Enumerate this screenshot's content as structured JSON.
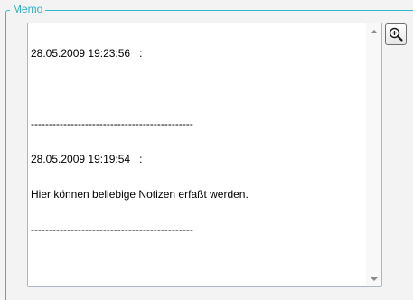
{
  "memo_group": {
    "title": "Memo"
  },
  "memo": {
    "lines": [
      "28.05.2009 19:23:56   :",
      "",
      "---------------------------------------------",
      "28.05.2009 19:19:54   :",
      "Hier können beliebige Notizen erfaßt werden.",
      "---------------------------------------------"
    ]
  },
  "icons": {
    "zoom": "zoom-in-icon",
    "scroll_up": "arrow-up-icon",
    "scroll_down": "arrow-down-icon"
  }
}
